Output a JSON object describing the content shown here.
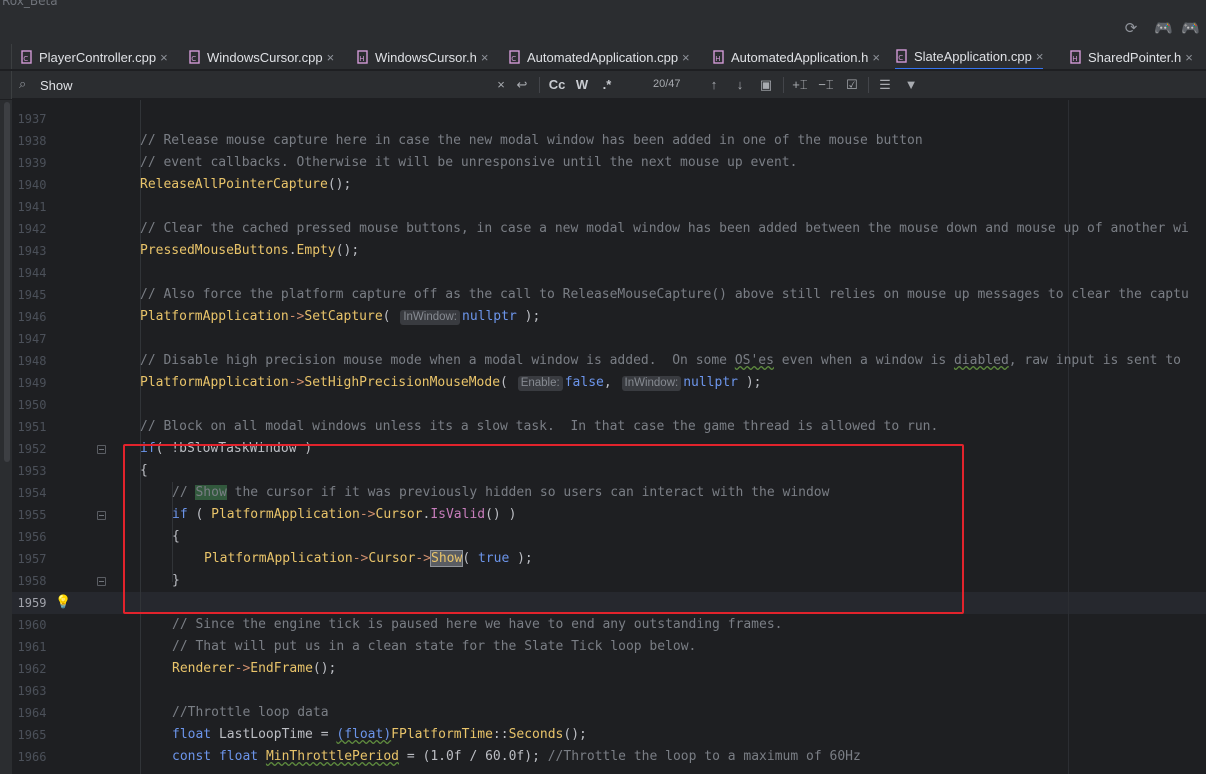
{
  "window": {
    "title": "Rox_Beta"
  },
  "tabs": [
    {
      "label": "PlayerController.cpp",
      "active": false
    },
    {
      "label": "WindowsCursor.cpp",
      "active": false
    },
    {
      "label": "WindowsCursor.h",
      "active": false
    },
    {
      "label": "AutomatedApplication.cpp",
      "active": false
    },
    {
      "label": "AutomatedApplication.h",
      "active": false
    },
    {
      "label": "SlateApplication.cpp",
      "active": true
    },
    {
      "label": "SharedPointer.h",
      "active": false
    }
  ],
  "tab_close_glyph": "×",
  "find": {
    "query": "Show",
    "match_count": "20/47",
    "case_label": "Cc",
    "words_label": "W",
    "regex_label": ".*"
  },
  "editor": {
    "current_line": "1959",
    "line_numbers": [
      "1937",
      "1938",
      "1939",
      "1940",
      "1941",
      "1942",
      "1943",
      "1944",
      "1945",
      "1946",
      "1947",
      "1948",
      "1949",
      "1950",
      "1951",
      "1952",
      "1953",
      "1954",
      "1955",
      "1956",
      "1957",
      "1958",
      "1959",
      "1960",
      "1961",
      "1962",
      "1963",
      "1964",
      "1965",
      "1966"
    ],
    "code": {
      "l1937": "",
      "l1938": "// Release mouse capture here in case the new modal window has been added in one of the mouse button",
      "l1939": "// event callbacks. Otherwise it will be unresponsive until the next mouse up event.",
      "l1940_fn": "ReleaseAllPointerCapture",
      "l1940_rest": "();",
      "l1942": "// Clear the cached pressed mouse buttons, in case a new modal window has been added between the mouse down and mouse up of another wi",
      "l1943_var": "PressedMouseButtons",
      "l1943_dot": ".",
      "l1943_fn": "Empty",
      "l1943_rest": "();",
      "l1945": "// Also force the platform capture off as the call to ReleaseMouseCapture() above still relies on mouse up messages to clear the captu",
      "l1946_var": "PlatformApplication",
      "l1946_arrow": "->",
      "l1946_fn": "SetCapture",
      "l1946_open": "( ",
      "l1946_hint": "InWindow:",
      "l1946_val": "nullptr",
      "l1946_close": " );",
      "l1948_a": "// Disable high precision mouse mode when a modal window is added.  On some ",
      "l1948_os": "OS'es",
      "l1948_b": " even when a window is ",
      "l1948_diabled": "diabled",
      "l1948_c": ", raw input is sent to",
      "l1949_var": "PlatformApplication",
      "l1949_arrow": "->",
      "l1949_fn": "SetHighPrecisionMouseMode",
      "l1949_open": "( ",
      "l1949_hint1": "Enable:",
      "l1949_val1": "false",
      "l1949_comma": ", ",
      "l1949_hint2": "InWindow:",
      "l1949_val2": "nullptr",
      "l1949_close": " );",
      "l1951": "// Block on all modal windows unless its a slow task.  In that case the game thread is allowed to run.",
      "l1952_kw": "if",
      "l1952_rest": "( !bSlowTaskWindow )",
      "l1953": "{",
      "l1954_a": "// ",
      "l1954_show": "Show",
      "l1954_b": " the cursor if it was previously hidden so users can interact with the window",
      "l1955_kw": "if",
      "l1955_open": " ( ",
      "l1955_var": "PlatformApplication",
      "l1955_arrow": "->",
      "l1955_cur": "Cursor",
      "l1955_dot": ".",
      "l1955_fn": "IsValid",
      "l1955_close": "() )",
      "l1956": "{",
      "l1957_var": "PlatformApplication",
      "l1957_arrow1": "->",
      "l1957_cur": "Cursor",
      "l1957_arrow2": "->",
      "l1957_show": "Show",
      "l1957_open": "( ",
      "l1957_true": "true",
      "l1957_close": " );",
      "l1958": "}",
      "l1960": "// Since the engine tick is paused here we have to end any outstanding frames.",
      "l1961": "// That will put us in a clean state for the Slate Tick loop below.",
      "l1962_var": "Renderer",
      "l1962_arrow": "->",
      "l1962_fn": "EndFrame",
      "l1962_rest": "();",
      "l1964": "//Throttle loop data",
      "l1965_kw": "float",
      "l1965_a": " LastLoopTime = ",
      "l1965_cast": "(float)",
      "l1965_cls": "FPlatformTime",
      "l1965_sc": "::",
      "l1965_fn": "Seconds",
      "l1965_rest": "();",
      "l1966_kw1": "const",
      "l1966_kw2": " float",
      "l1966_a": " ",
      "l1966_var": "MinThrottlePeriod",
      "l1966_b": " = (",
      "l1966_n1": "1.0f",
      "l1966_c": " / ",
      "l1966_n2": "60.0f",
      "l1966_d": "); ",
      "l1966_com": "//Throttle the loop to a maximum of 60Hz"
    }
  },
  "colors": {
    "accent": "#3574f0",
    "annotation_box": "#e2232c"
  }
}
